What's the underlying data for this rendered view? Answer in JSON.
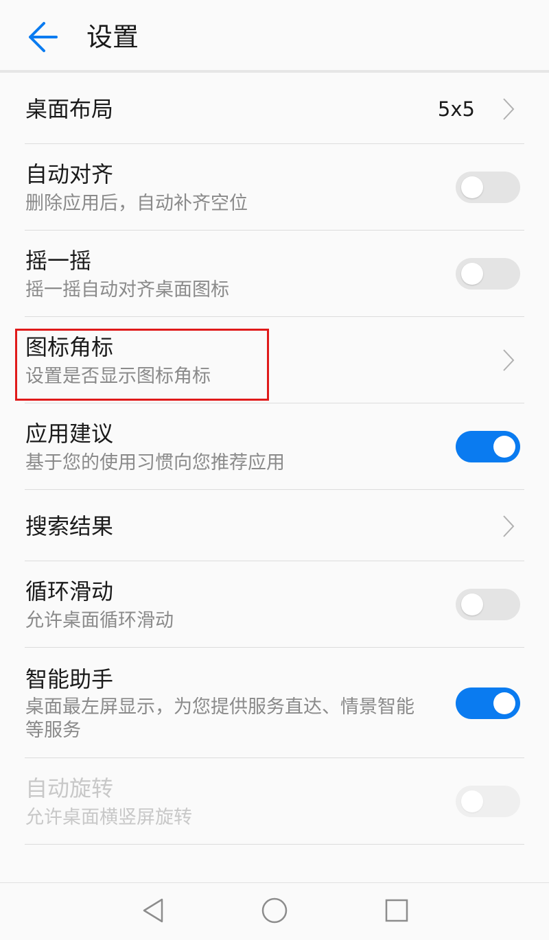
{
  "header": {
    "title": "设置",
    "back_icon": "arrow-left-icon",
    "accent_color": "#0a7bf0"
  },
  "settings": [
    {
      "title": "桌面布局",
      "value": "5x5",
      "type": "nav"
    },
    {
      "title": "自动对齐",
      "subtitle": "删除应用后，自动补齐空位",
      "type": "toggle",
      "on": false
    },
    {
      "title": "摇一摇",
      "subtitle": "摇一摇自动对齐桌面图标",
      "type": "toggle",
      "on": false
    },
    {
      "title": "图标角标",
      "subtitle": "设置是否显示图标角标",
      "type": "nav",
      "highlighted": true
    },
    {
      "title": "应用建议",
      "subtitle": "基于您的使用习惯向您推荐应用",
      "type": "toggle",
      "on": true
    },
    {
      "title": "搜索结果",
      "type": "nav"
    },
    {
      "title": "循环滑动",
      "subtitle": "允许桌面循环滑动",
      "type": "toggle",
      "on": false
    },
    {
      "title": "智能助手",
      "subtitle": "桌面最左屏显示，为您提供服务直达、情景智能等服务",
      "type": "toggle",
      "on": true
    },
    {
      "title": "自动旋转",
      "subtitle": "允许桌面横竖屏旋转",
      "type": "toggle",
      "on": false,
      "disabled": true
    }
  ],
  "navbar": {
    "back_icon": "triangle-back-icon",
    "home_icon": "circle-home-icon",
    "recents_icon": "square-recents-icon"
  },
  "colors": {
    "toggle_on": "#0a7bf0",
    "toggle_off": "#e4e4e4",
    "highlight_border": "#e01a1a"
  }
}
